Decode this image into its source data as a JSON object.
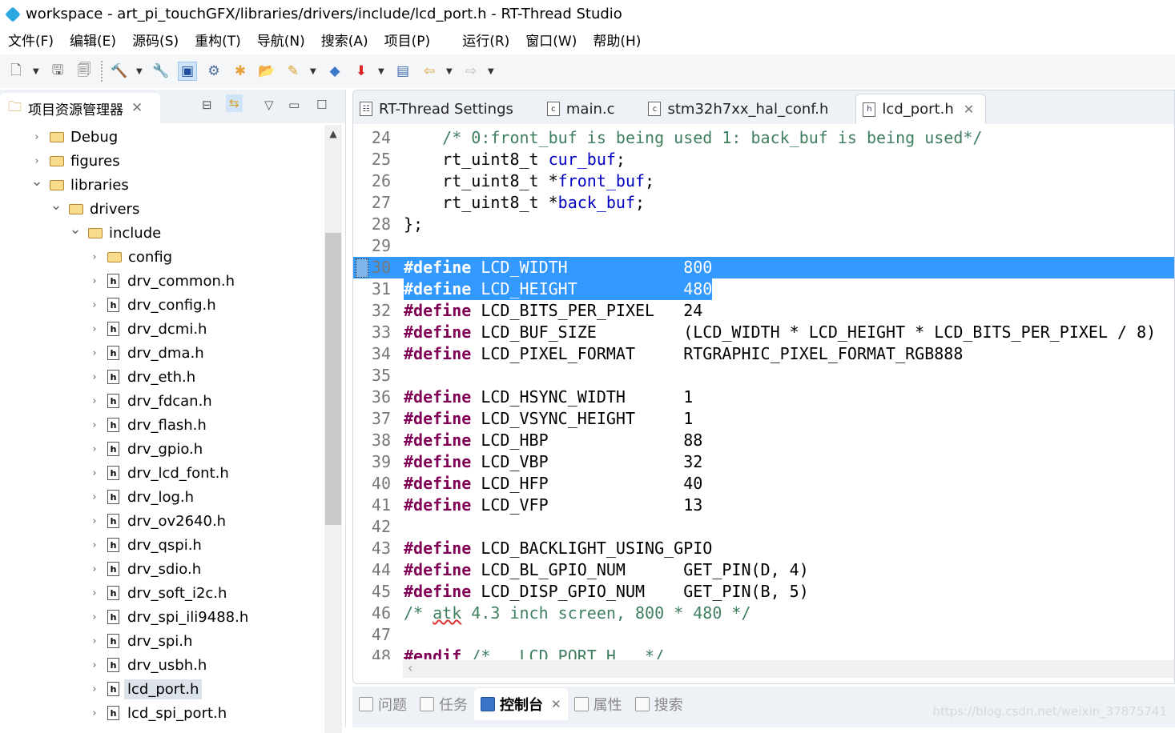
{
  "window": {
    "title": "workspace - art_pi_touchGFX/libraries/drivers/include/lcd_port.h - RT-Thread Studio"
  },
  "menu": [
    "文件(F)",
    "编辑(E)",
    "源码(S)",
    "重构(T)",
    "导航(N)",
    "搜索(A)",
    "项目(P)",
    "运行(R)",
    "窗口(W)",
    "帮助(H)"
  ],
  "explorer": {
    "title": "项目资源管理器",
    "items": [
      {
        "label": "Debug",
        "type": "folder",
        "level": 0,
        "expanded": false
      },
      {
        "label": "figures",
        "type": "folder",
        "level": 0,
        "expanded": false
      },
      {
        "label": "libraries",
        "type": "folder",
        "level": 0,
        "expanded": true
      },
      {
        "label": "drivers",
        "type": "folder",
        "level": 1,
        "expanded": true
      },
      {
        "label": "include",
        "type": "folder",
        "level": 2,
        "expanded": true
      },
      {
        "label": "config",
        "type": "folder",
        "level": 3,
        "expanded": false
      },
      {
        "label": "drv_common.h",
        "type": "h",
        "level": 3
      },
      {
        "label": "drv_config.h",
        "type": "h",
        "level": 3
      },
      {
        "label": "drv_dcmi.h",
        "type": "h",
        "level": 3
      },
      {
        "label": "drv_dma.h",
        "type": "h",
        "level": 3
      },
      {
        "label": "drv_eth.h",
        "type": "h",
        "level": 3
      },
      {
        "label": "drv_fdcan.h",
        "type": "h",
        "level": 3
      },
      {
        "label": "drv_flash.h",
        "type": "h",
        "level": 3
      },
      {
        "label": "drv_gpio.h",
        "type": "h",
        "level": 3
      },
      {
        "label": "drv_lcd_font.h",
        "type": "h",
        "level": 3
      },
      {
        "label": "drv_log.h",
        "type": "h",
        "level": 3
      },
      {
        "label": "drv_ov2640.h",
        "type": "h",
        "level": 3
      },
      {
        "label": "drv_qspi.h",
        "type": "h",
        "level": 3
      },
      {
        "label": "drv_sdio.h",
        "type": "h",
        "level": 3
      },
      {
        "label": "drv_soft_i2c.h",
        "type": "h",
        "level": 3
      },
      {
        "label": "drv_spi_ili9488.h",
        "type": "h",
        "level": 3
      },
      {
        "label": "drv_spi.h",
        "type": "h",
        "level": 3
      },
      {
        "label": "drv_usbh.h",
        "type": "h",
        "level": 3
      },
      {
        "label": "lcd_port.h",
        "type": "h",
        "level": 3,
        "selected": true
      },
      {
        "label": "lcd_spi_port.h",
        "type": "h",
        "level": 3
      }
    ]
  },
  "editor": {
    "tabs": [
      {
        "label": "RT-Thread Settings",
        "icon": "settings-icon"
      },
      {
        "label": "main.c",
        "icon": "c-file-icon"
      },
      {
        "label": "stm32h7xx_hal_conf.h",
        "icon": "c-file-icon"
      },
      {
        "label": "lcd_port.h",
        "icon": "h-file-icon",
        "active": true
      }
    ],
    "lines": [
      {
        "n": "24",
        "segs": [
          [
            "    ",
            ""
          ],
          [
            "/* 0:front_buf is being used 1: back_buf is being used*/",
            "cm"
          ]
        ]
      },
      {
        "n": "25",
        "segs": [
          [
            "    rt_uint8_t ",
            ""
          ],
          [
            "cur_buf",
            "fld"
          ],
          [
            ";",
            ""
          ]
        ]
      },
      {
        "n": "26",
        "segs": [
          [
            "    rt_uint8_t *",
            ""
          ],
          [
            "front_buf",
            "fld"
          ],
          [
            ";",
            ""
          ]
        ]
      },
      {
        "n": "27",
        "segs": [
          [
            "    rt_uint8_t *",
            ""
          ],
          [
            "back_buf",
            "fld"
          ],
          [
            ";",
            ""
          ]
        ]
      },
      {
        "n": "28",
        "segs": [
          [
            "};",
            ""
          ]
        ]
      },
      {
        "n": "29",
        "segs": []
      },
      {
        "n": "30",
        "hl": "full",
        "segs": [
          [
            "#define",
            "kw"
          ],
          [
            " LCD_WIDTH            800",
            ""
          ]
        ]
      },
      {
        "n": "31",
        "hl": "part",
        "segs": [
          [
            "#define",
            "kw"
          ],
          [
            " LCD_HEIGHT           480",
            ""
          ]
        ]
      },
      {
        "n": "32",
        "segs": [
          [
            "#define",
            "kw"
          ],
          [
            " LCD_BITS_PER_PIXEL   24",
            ""
          ]
        ]
      },
      {
        "n": "33",
        "segs": [
          [
            "#define",
            "kw"
          ],
          [
            " LCD_BUF_SIZE         (LCD_WIDTH * LCD_HEIGHT * LCD_BITS_PER_PIXEL / 8)",
            ""
          ]
        ]
      },
      {
        "n": "34",
        "segs": [
          [
            "#define",
            "kw"
          ],
          [
            " LCD_PIXEL_FORMAT     RTGRAPHIC_PIXEL_FORMAT_RGB888",
            ""
          ]
        ]
      },
      {
        "n": "35",
        "segs": []
      },
      {
        "n": "36",
        "segs": [
          [
            "#define",
            "kw"
          ],
          [
            " LCD_HSYNC_WIDTH      1",
            ""
          ]
        ]
      },
      {
        "n": "37",
        "segs": [
          [
            "#define",
            "kw"
          ],
          [
            " LCD_VSYNC_HEIGHT     1",
            ""
          ]
        ]
      },
      {
        "n": "38",
        "segs": [
          [
            "#define",
            "kw"
          ],
          [
            " LCD_HBP              88",
            ""
          ]
        ]
      },
      {
        "n": "39",
        "segs": [
          [
            "#define",
            "kw"
          ],
          [
            " LCD_VBP              32",
            ""
          ]
        ]
      },
      {
        "n": "40",
        "segs": [
          [
            "#define",
            "kw"
          ],
          [
            " LCD_HFP              40",
            ""
          ]
        ]
      },
      {
        "n": "41",
        "segs": [
          [
            "#define",
            "kw"
          ],
          [
            " LCD_VFP              13",
            ""
          ]
        ]
      },
      {
        "n": "42",
        "segs": []
      },
      {
        "n": "43",
        "segs": [
          [
            "#define",
            "kw"
          ],
          [
            " LCD_BACKLIGHT_USING_GPIO",
            ""
          ]
        ]
      },
      {
        "n": "44",
        "segs": [
          [
            "#define",
            "kw"
          ],
          [
            " LCD_BL_GPIO_NUM      GET_PIN(D, 4)",
            ""
          ]
        ]
      },
      {
        "n": "45",
        "segs": [
          [
            "#define",
            "kw"
          ],
          [
            " LCD_DISP_GPIO_NUM    GET_PIN(B, 5)",
            ""
          ]
        ]
      },
      {
        "n": "46",
        "segs": [
          [
            "/* ",
            "cm"
          ],
          [
            "atk",
            "cm sq"
          ],
          [
            " 4.3 inch screen, 800 * 480 */",
            "cm"
          ]
        ]
      },
      {
        "n": "47",
        "segs": []
      },
      {
        "n": "48",
        "segs": [
          [
            "#endif",
            "kw"
          ],
          [
            " /* __LCD_PORT_H__ */",
            "cm"
          ]
        ]
      }
    ]
  },
  "bottom": {
    "tabs": [
      {
        "label": "问题",
        "icon": "problems-icon"
      },
      {
        "label": "任务",
        "icon": "tasks-icon"
      },
      {
        "label": "控制台",
        "icon": "console-icon",
        "active": true
      },
      {
        "label": "属性",
        "icon": "properties-icon"
      },
      {
        "label": "搜索",
        "icon": "search-icon"
      }
    ],
    "watermark": "https://blog.csdn.net/weixin_37875741"
  },
  "colors": {
    "keyword": "#7f0055",
    "comment": "#3f7f5f",
    "field": "#0000c0",
    "selection": "#3399ff"
  }
}
